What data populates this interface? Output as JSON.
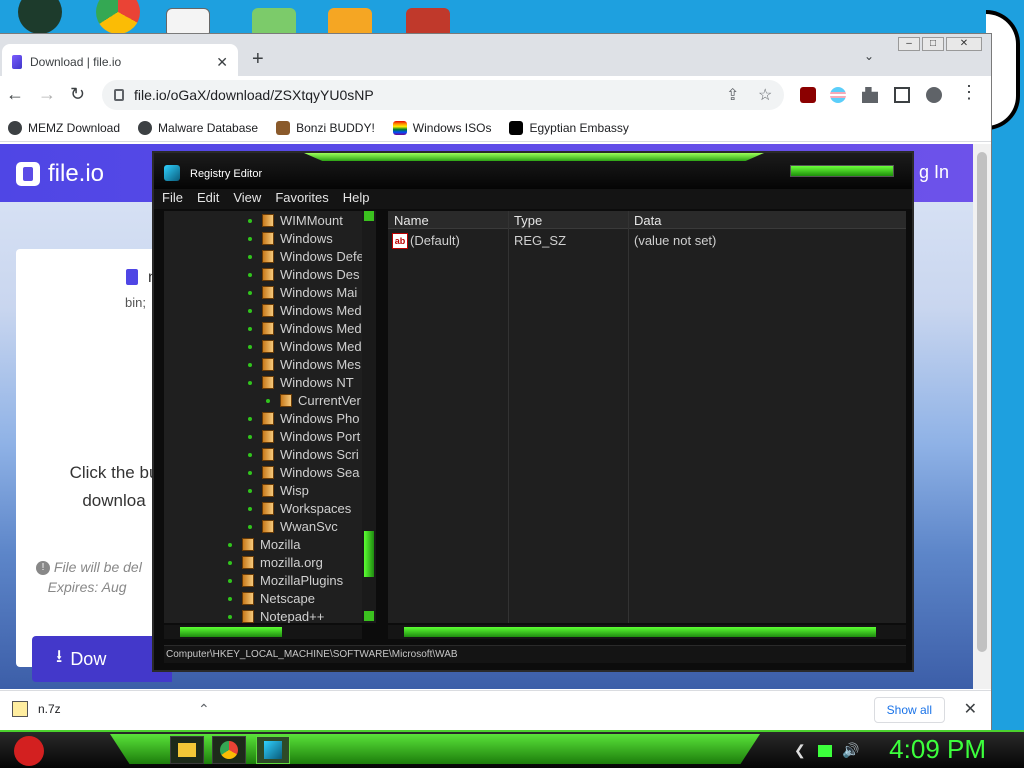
{
  "browser": {
    "tab_title": "Download | file.io",
    "url": "file.io/oGaX/download/ZSXtqyYU0sNP",
    "bookmarks": [
      "MEMZ Download",
      "Malware Database",
      "Bonzi BUDDY!",
      "Windows ISOs",
      "Egyptian Embassy"
    ],
    "page": {
      "brand": "file.io",
      "login": "g In",
      "file_name_partial": "n",
      "file_sub_partial": "bin;",
      "click_text": "Click the bu downloa",
      "warn_line1": "File will be del",
      "warn_line2": "Expires: Aug",
      "download_btn": "Dow"
    },
    "download": {
      "filename": "n.7z",
      "show_all": "Show all"
    }
  },
  "regedit": {
    "title": "Registry Editor",
    "menu": [
      "File",
      "Edit",
      "View",
      "Favorites",
      "Help"
    ],
    "tree": [
      {
        "label": "WIMMount",
        "indent": 1
      },
      {
        "label": "Windows",
        "indent": 1
      },
      {
        "label": "Windows Defe",
        "indent": 1
      },
      {
        "label": "Windows Des",
        "indent": 1
      },
      {
        "label": "Windows Mai",
        "indent": 1
      },
      {
        "label": "Windows Med",
        "indent": 1
      },
      {
        "label": "Windows Med",
        "indent": 1
      },
      {
        "label": "Windows Med",
        "indent": 1
      },
      {
        "label": "Windows Mes",
        "indent": 1
      },
      {
        "label": "Windows NT",
        "indent": 1
      },
      {
        "label": "CurrentVer",
        "indent": 2
      },
      {
        "label": "Windows Pho",
        "indent": 1
      },
      {
        "label": "Windows Port",
        "indent": 1
      },
      {
        "label": "Windows Scri",
        "indent": 1
      },
      {
        "label": "Windows Sea",
        "indent": 1
      },
      {
        "label": "Wisp",
        "indent": 1
      },
      {
        "label": "Workspaces",
        "indent": 1
      },
      {
        "label": "WwanSvc",
        "indent": 1
      },
      {
        "label": "Mozilla",
        "indent": 0
      },
      {
        "label": "mozilla.org",
        "indent": 0
      },
      {
        "label": "MozillaPlugins",
        "indent": 0
      },
      {
        "label": "Netscape",
        "indent": 0
      },
      {
        "label": "Notepad++",
        "indent": 0
      }
    ],
    "columns": [
      "Name",
      "Type",
      "Data"
    ],
    "values": [
      {
        "name": "(Default)",
        "type": "REG_SZ",
        "data": "(value not set)"
      }
    ],
    "value_icon_text": "ab",
    "status": "Computer\\HKEY_LOCAL_MACHINE\\SOFTWARE\\Microsoft\\WAB"
  },
  "taskbar": {
    "clock": "4:09 PM"
  },
  "colors": {
    "accent_green": "#3cff3c",
    "brand_purple": "#4f46e5"
  }
}
